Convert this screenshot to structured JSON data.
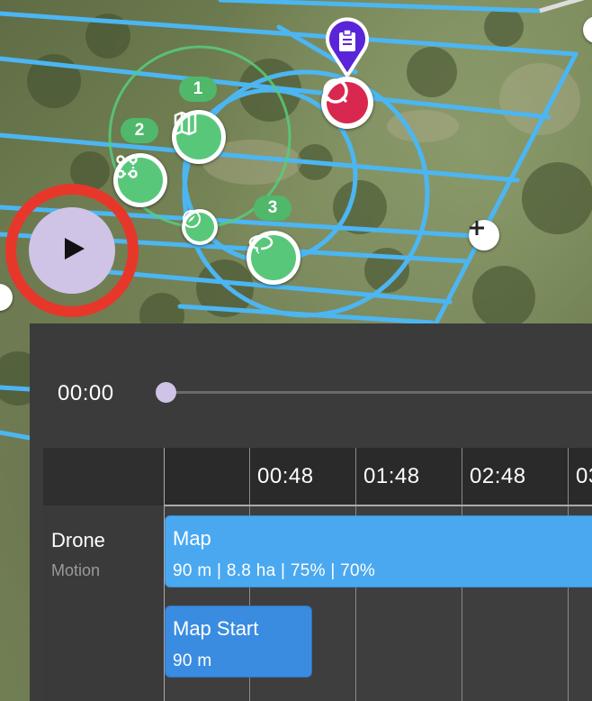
{
  "map": {
    "waypoints": [
      {
        "number": "1",
        "icon": "map-icon"
      },
      {
        "number": "2",
        "icon": "route-icon"
      },
      {
        "number": "3",
        "icon": "orbit-icon"
      }
    ],
    "poi_icon": "clipboard-icon",
    "target_icon": "target-icon",
    "compass_icon": "compass-icon",
    "add_icon": "plus-icon",
    "colors": {
      "flight_path": "#4cb6f2",
      "waypoint_green": "#59c77a",
      "poi_purple": "#5a24d9",
      "target_red": "#d9284f",
      "play_ring": "#e7372b",
      "play_fill": "#cfc3e6"
    }
  },
  "player": {
    "play_icon": "play-icon",
    "time": "00:00"
  },
  "timeline": {
    "ticks": [
      "00:48",
      "01:48",
      "02:48",
      "03"
    ],
    "track": {
      "name": "Drone",
      "sub": "Motion"
    },
    "blocks": [
      {
        "title": "Map",
        "detail": "90 m | 8.8 ha | 75% | 70%"
      },
      {
        "title": "Map Start",
        "detail": "90 m"
      }
    ]
  }
}
